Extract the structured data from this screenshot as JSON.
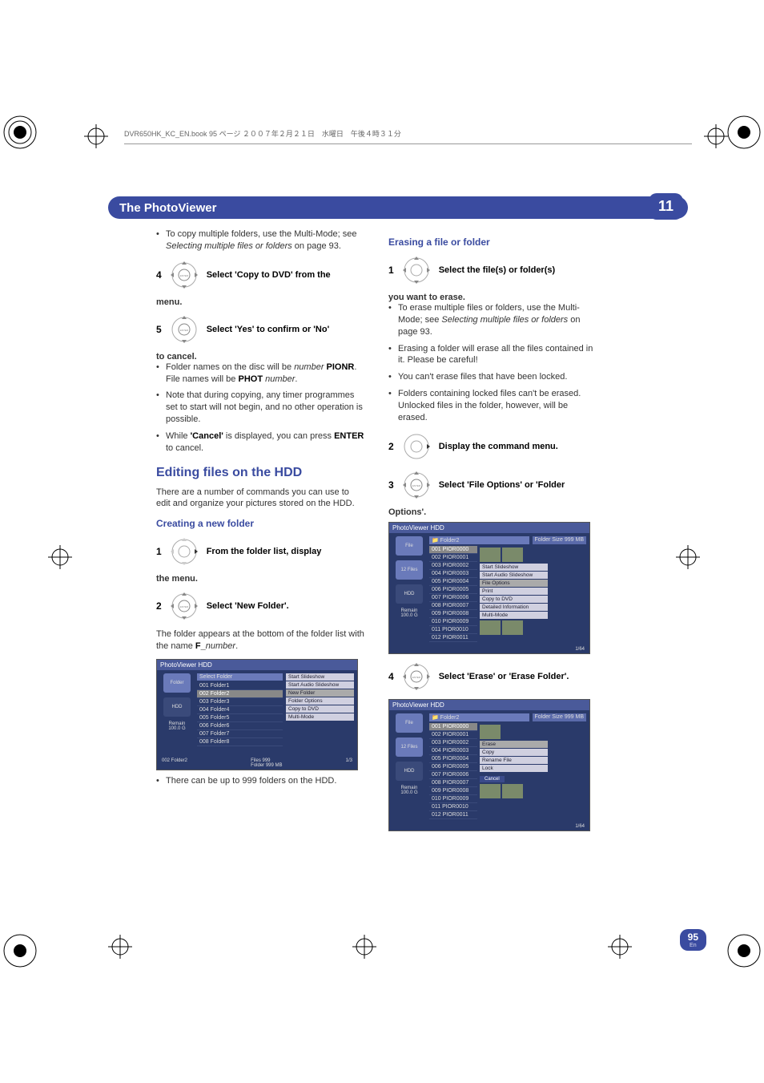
{
  "header": {
    "book": "DVR650HK_KC_EN.book 95 ページ ２００７年２月２１日　水曜日　午後４時３１分"
  },
  "chapter": {
    "title": "The PhotoViewer",
    "num": "11"
  },
  "left": {
    "copy_multi": "To copy multiple folders, use the Multi-Mode; see ",
    "copy_multi_em": "Selecting multiple files or folders",
    "copy_multi_pg": " on page 93.",
    "s4": "4",
    "s4t": "Select 'Copy to DVD' from the",
    "s4c": "menu.",
    "s5": "5",
    "s5t": "Select 'Yes' to confirm or 'No'",
    "s5c": "to cancel.",
    "b1a": "Folder names on the disc will be ",
    "b1b": "number",
    "b1c": " PIONR",
    "b1d": ". File names will be ",
    "b1e": "PHOT",
    "b1f": " number",
    "b1g": ".",
    "b2": "Note that during copying, any timer programmes set to start will not begin, and no other operation is possible.",
    "b3a": "While ",
    "b3b": "'Cancel'",
    "b3c": " is displayed, you can press ",
    "b3d": "ENTER",
    "b3e": " to cancel.",
    "h2": "Editing files on the HDD",
    "intro": "There are a number of commands you can use to edit and organize your pictures stored on the HDD.",
    "h3": "Creating a new folder",
    "c1": "1",
    "c1t": "From the folder list, display",
    "c1c": "the menu.",
    "c2": "2",
    "c2t": "Select 'New Folder'.",
    "c2body_a": "The folder appears at the bottom of the folder list with the name ",
    "c2body_b": "F_",
    "c2body_c": "number",
    "c2body_d": ".",
    "max": "There can be up to 999 folders on the HDD."
  },
  "right": {
    "h3": "Erasing a file or folder",
    "s1": "1",
    "s1t": "Select the file(s) or folder(s)",
    "s1c": "you want to erase.",
    "b1a": "To erase multiple files or folders, use the Multi-Mode; see ",
    "b1b": "Selecting multiple files or folders",
    "b1c": " on page 93.",
    "b2": "Erasing a folder will erase all the files contained in it. Please be careful!",
    "b3": "You can't erase files that have been locked.",
    "b4": "Folders containing locked files can't be erased. Unlocked files in the folder, however, will be erased.",
    "s2": "2",
    "s2t": "Display the command menu.",
    "s3": "3",
    "s3t": "Select 'File Options' or 'Folder",
    "s3c": "Options'.",
    "s4": "4",
    "s4t": "Select 'Erase' or 'Erase Folder'."
  },
  "scrn1": {
    "title": "PhotoViewer  HDD",
    "hdr": "Select Folder",
    "rows": [
      "001  Folder1",
      "002  Folder2",
      "003  Folder3",
      "004  Folder4",
      "005  Folder5",
      "006  Folder6",
      "007  Folder7",
      "008  Folder8"
    ],
    "sel_idx": 1,
    "menu": [
      "Start Slideshow",
      "Start Audio Slideshow",
      "New Folder",
      "Folder Options",
      "Copy to DVD",
      "Multi-Mode"
    ],
    "menu_hl": 2,
    "side1": "Folder",
    "side2": "HDD",
    "side3": "Remain",
    "side4": "100.0 G",
    "foot_l": "002  Folder2",
    "foot_m1": "Files        999",
    "foot_m2": "Folder    999 MB",
    "foot_r": "1/3"
  },
  "scrn2": {
    "title": "PhotoViewer  HDD",
    "folder": "Folder2",
    "size": "Folder Size 999 MB",
    "rows": [
      "001 PIOR0000",
      "002 PIOR0001",
      "003 PIOR0002",
      "004 PIOR0003",
      "005 PIOR0004",
      "006 PIOR0005",
      "007 PIOR0006",
      "008 PIOR0007",
      "009 PIOR0008",
      "010 PIOR0009",
      "011 PIOR0010",
      "012 PIOR0011"
    ],
    "menu": [
      "Start Slideshow",
      "Start Audio Slideshow",
      "File Options",
      "Print",
      "Copy to DVD",
      "Detailed Information",
      "Multi-Mode"
    ],
    "menu_hl": 2,
    "side1": "File",
    "side2": "12 Files",
    "side3": "HDD",
    "side4": "Remain",
    "side5": "100.0 G",
    "foot_r": "1/64"
  },
  "scrn3": {
    "title": "PhotoViewer  HDD",
    "folder": "Folder2",
    "size": "Folder Size 999 MB",
    "rows": [
      "001 PIOR0000",
      "002 PIOR0001",
      "003 PIOR0002",
      "004 PIOR0003",
      "005 PIOR0004",
      "006 PIOR0005",
      "007 PIOR0006",
      "008 PIOR0007",
      "009 PIOR0008",
      "010 PIOR0009",
      "011 PIOR0010",
      "012 PIOR0011"
    ],
    "menu": [
      "Erase",
      "Copy",
      "Rename File",
      "Lock"
    ],
    "menu_hl": 0,
    "cancel": "Cancel",
    "side1": "File",
    "side2": "12 Files",
    "side3": "HDD",
    "side4": "Remain",
    "side5": "100.0 G",
    "foot_r": "1/64"
  },
  "page": {
    "num": "95",
    "lang": "En"
  }
}
